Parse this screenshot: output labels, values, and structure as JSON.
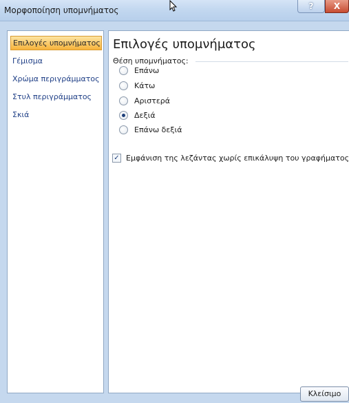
{
  "window": {
    "title": "Μορφοποίηση υπομνήματος",
    "help_label": "?",
    "close_label": "X"
  },
  "sidebar": {
    "items": [
      {
        "label": "Επιλογές υπομνήματος",
        "selected": true
      },
      {
        "label": "Γέμισμα",
        "selected": false
      },
      {
        "label": "Χρώμα περιγράμματος",
        "selected": false
      },
      {
        "label": "Στυλ περιγράμματος",
        "selected": false
      },
      {
        "label": "Σκιά",
        "selected": false
      }
    ]
  },
  "main": {
    "heading": "Επιλογές υπομνήματος",
    "position_label": "Θέση υπομνήματος:",
    "position_options": [
      {
        "label": "Επάνω",
        "checked": false
      },
      {
        "label": "Κάτω",
        "checked": false
      },
      {
        "label": "Αριστερά",
        "checked": false
      },
      {
        "label": "Δεξιά",
        "checked": true
      },
      {
        "label": "Επάνω δεξιά",
        "checked": false
      }
    ],
    "overlap_checkbox": {
      "label": "Εμφάνιση της λεζάντας χωρίς επικάλυψη του γραφήματος",
      "checked": true
    }
  },
  "footer": {
    "close_button": "Κλείσιμο"
  }
}
